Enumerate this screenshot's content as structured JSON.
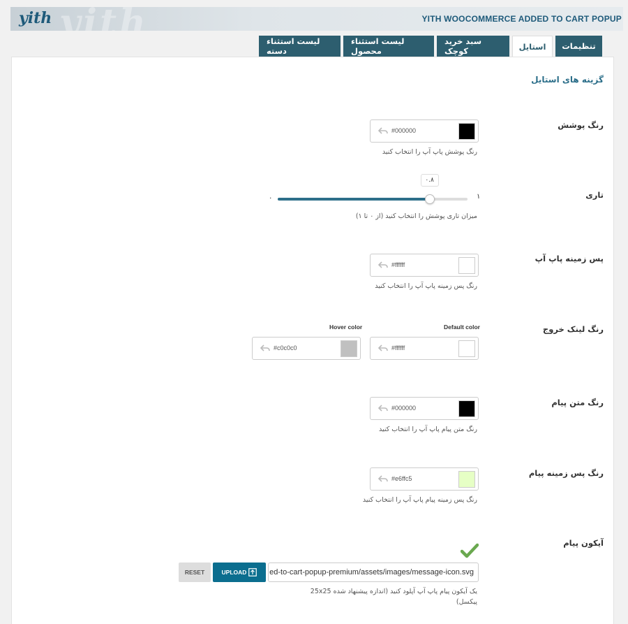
{
  "header": {
    "logo": "yith",
    "watermark": "yith",
    "plugin_title": "YITH WOOCOMMERCE ADDED TO CART POPUP"
  },
  "tabs": [
    {
      "label": "لیست استثناء دسته",
      "active": false
    },
    {
      "label": "لیست استثناء محصول",
      "active": false
    },
    {
      "label": "سبد خرید کوچک",
      "active": false
    },
    {
      "label": "استایل",
      "active": true
    },
    {
      "label": "تنظیمات",
      "active": false
    }
  ],
  "section_title": "گزینه های استایل",
  "fields": {
    "overlay_color": {
      "label": "رنگ پوشش",
      "hex": "#000000",
      "swatch": "#000000",
      "desc": "رنگ پوشش پاپ آپ را انتخاب کنید"
    },
    "opacity": {
      "label": "تاری",
      "value": 0.8,
      "value_label": "۰.۸",
      "min_label": "۰",
      "max_label": "۱",
      "desc": "میزان تاری پوشش را انتخاب کنید (از ۰ تا ۱)"
    },
    "popup_bg": {
      "label": "پس زمینه پاپ آپ",
      "hex": "#ffffff",
      "swatch": "#ffffff",
      "desc": "رنگ پس زمینه پاپ آپ را انتخاب کنید"
    },
    "close_link": {
      "label": "رنگ لینک خروج",
      "default_head": "Default color",
      "hover_head": "Hover color",
      "default_hex": "#ffffff",
      "default_swatch": "#ffffff",
      "hover_hex": "#c0c0c0",
      "hover_swatch": "#c0c0c0"
    },
    "message_text": {
      "label": "رنگ متن پیام",
      "hex": "#000000",
      "swatch": "#000000",
      "desc": "رنگ متن پیام پاپ آپ را انتخاب کنید"
    },
    "message_bg": {
      "label": "رنگ پس زمینه پیام",
      "hex": "#e6ffc5",
      "swatch": "#e6ffc5",
      "desc": "رنگ پس زمینه پیام پاپ آپ را انتخاب کنید"
    },
    "message_icon": {
      "label": "آیکون پیام",
      "path": "ed-to-cart-popup-premium/assets/images/message-icon.svg",
      "upload_label": "UPLOAD",
      "reset_label": "RESET",
      "desc_line1": "یک آیکون پیام پاپ آپ آپلود کنید (اندازه پیشنهاد شده 25x25",
      "desc_line2": "پیکسل)"
    }
  }
}
